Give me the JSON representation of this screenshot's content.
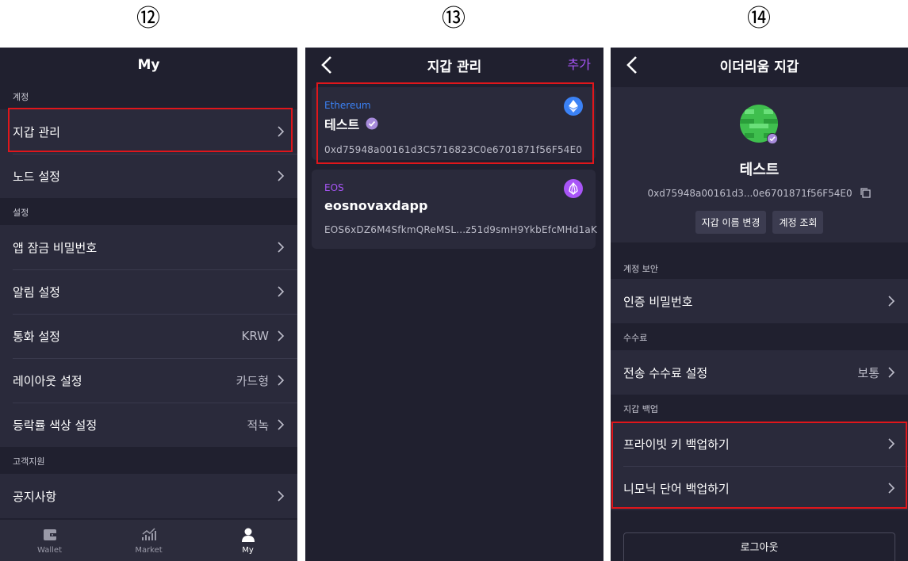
{
  "steps": [
    "⑫",
    "⑬",
    "⑭"
  ],
  "screen12": {
    "title": "My",
    "sections": [
      {
        "label": "계정",
        "rows": [
          {
            "label": "지갑 관리",
            "value": ""
          },
          {
            "label": "노드 설정",
            "value": ""
          }
        ]
      },
      {
        "label": "설정",
        "rows": [
          {
            "label": "앱 잠금 비밀번호",
            "value": ""
          },
          {
            "label": "알림 설정",
            "value": ""
          },
          {
            "label": "통화 설정",
            "value": "KRW"
          },
          {
            "label": "레이아웃 설정",
            "value": "카드형"
          },
          {
            "label": "등락률 색상 설정",
            "value": "적녹"
          }
        ]
      },
      {
        "label": "고객지원",
        "rows": [
          {
            "label": "공지사항",
            "value": ""
          }
        ]
      }
    ],
    "tabs": [
      "Wallet",
      "Market",
      "My"
    ]
  },
  "screen13": {
    "title": "지갑 관리",
    "add_label": "추가",
    "cards": [
      {
        "chain": "Ethereum",
        "name": "테스트",
        "address": "0xd75948a00161d3C5716823C0e6701871f56F54E0"
      },
      {
        "chain": "EOS",
        "name": "eosnovaxdapp",
        "address": "EOS6xDZ6M4SfkmQReMSL...z51d9smH9YkbEfcMHd1aK"
      }
    ]
  },
  "screen14": {
    "title": "이더리움 지갑",
    "name": "테스트",
    "address": "0xd75948a00161d3...0e6701871f56F54E0",
    "buttons": [
      "지갑 이름 변경",
      "계정 조회"
    ],
    "sections": [
      {
        "label": "계정 보안",
        "rows": [
          {
            "label": "인증 비밀번호",
            "value": ""
          }
        ]
      },
      {
        "label": "수수료",
        "rows": [
          {
            "label": "전송 수수료 설정",
            "value": "보통"
          }
        ]
      },
      {
        "label": "지갑 백업",
        "rows": [
          {
            "label": "프라이빗 키 백업하기",
            "value": ""
          },
          {
            "label": "니모닉 단어 백업하기",
            "value": ""
          }
        ]
      }
    ],
    "logout_label": "로그아웃"
  },
  "colors": {
    "accent": "#a855f7",
    "highlight": "#e0161b",
    "background": "#20202f",
    "row": "#2a2a3b",
    "ethereum": "#3b82f6",
    "eos": "#a855f7"
  }
}
